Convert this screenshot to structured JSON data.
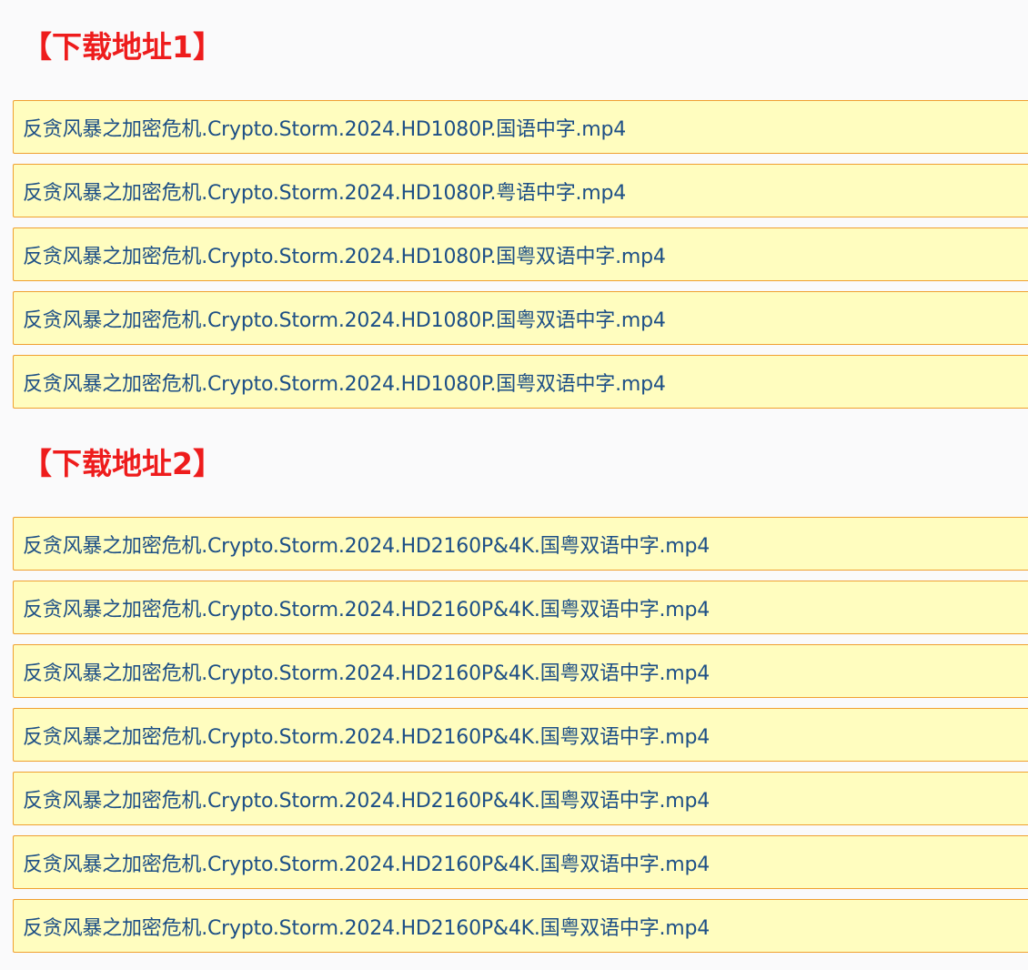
{
  "sections": [
    {
      "heading": "【下载地址1】",
      "links": [
        "反贪风暴之加密危机.Crypto.Storm.2024.HD1080P.国语中字.mp4",
        "反贪风暴之加密危机.Crypto.Storm.2024.HD1080P.粤语中字.mp4",
        "反贪风暴之加密危机.Crypto.Storm.2024.HD1080P.国粤双语中字.mp4",
        "反贪风暴之加密危机.Crypto.Storm.2024.HD1080P.国粤双语中字.mp4",
        "反贪风暴之加密危机.Crypto.Storm.2024.HD1080P.国粤双语中字.mp4"
      ]
    },
    {
      "heading": "【下载地址2】",
      "links": [
        "反贪风暴之加密危机.Crypto.Storm.2024.HD2160P&4K.国粤双语中字.mp4",
        "反贪风暴之加密危机.Crypto.Storm.2024.HD2160P&4K.国粤双语中字.mp4",
        "反贪风暴之加密危机.Crypto.Storm.2024.HD2160P&4K.国粤双语中字.mp4",
        "反贪风暴之加密危机.Crypto.Storm.2024.HD2160P&4K.国粤双语中字.mp4",
        "反贪风暴之加密危机.Crypto.Storm.2024.HD2160P&4K.国粤双语中字.mp4",
        "反贪风暴之加密危机.Crypto.Storm.2024.HD2160P&4K.国粤双语中字.mp4",
        "反贪风暴之加密危机.Crypto.Storm.2024.HD2160P&4K.国粤双语中字.mp4"
      ]
    }
  ],
  "colors": {
    "heading": "#ee1c1c",
    "link_text": "#1d4f86",
    "row_background": "#fffdbf",
    "row_border": "#f0a030"
  }
}
